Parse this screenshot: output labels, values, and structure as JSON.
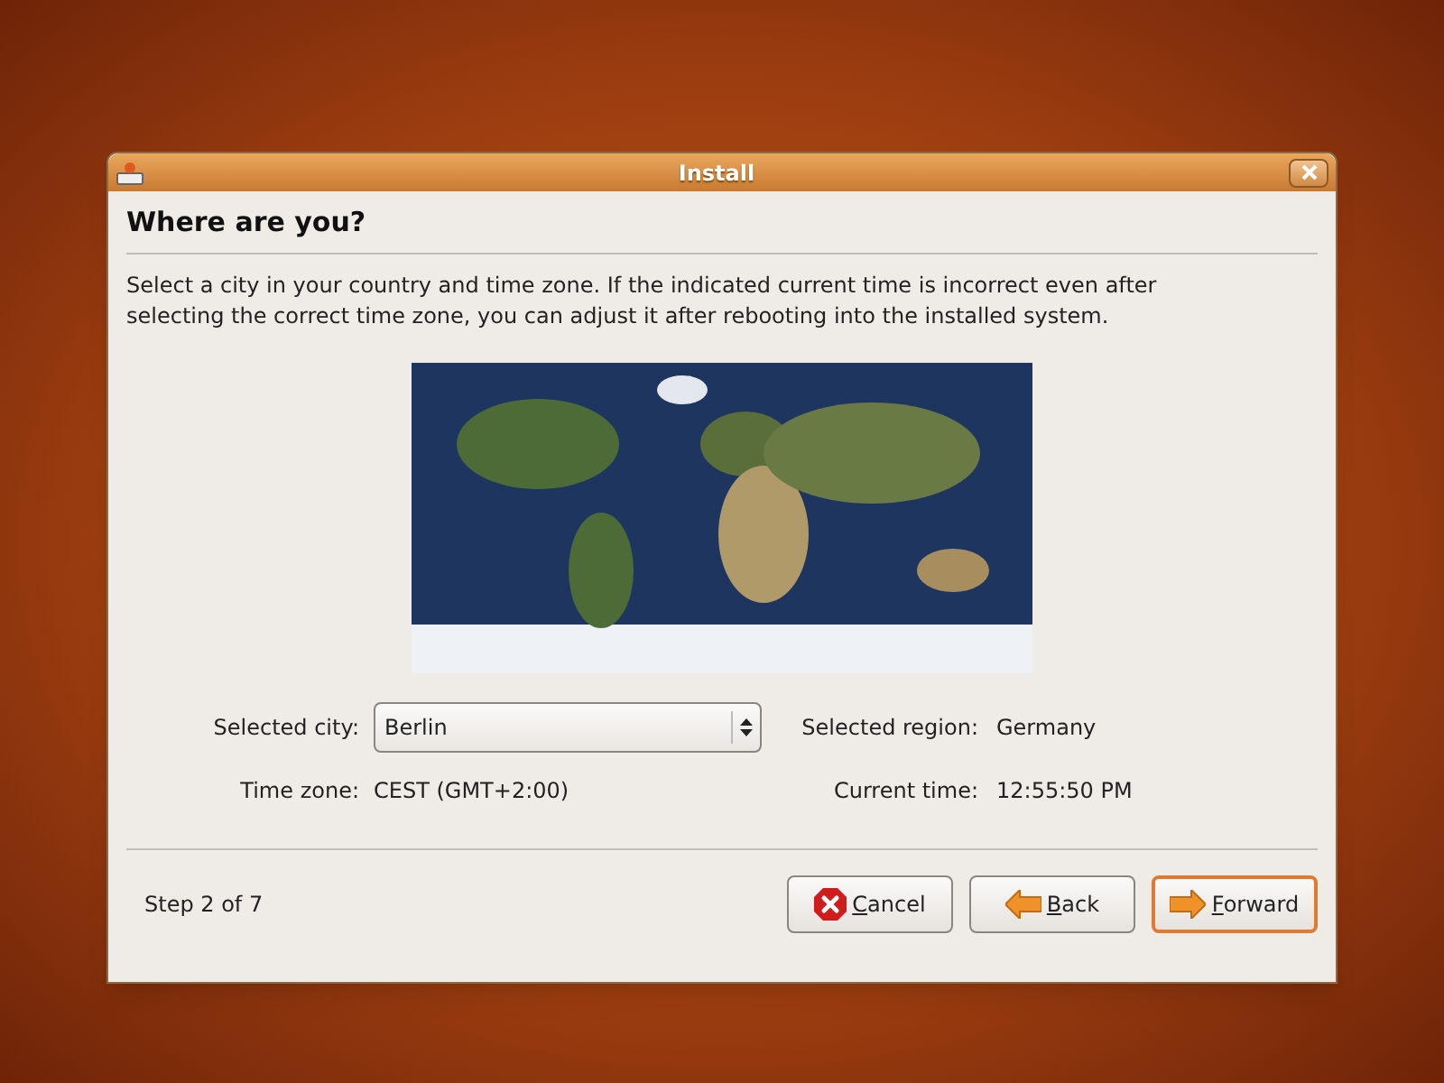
{
  "window": {
    "title": "Install"
  },
  "heading": "Where are you?",
  "description": "Select a city in your country and time zone. If the indicated current time is incorrect even after selecting the correct time zone, you can adjust it after rebooting into the installed system.",
  "fields": {
    "city_label": "Selected city:",
    "city_value": "Berlin",
    "region_label": "Selected region:",
    "region_value": "Germany",
    "timezone_label": "Time zone:",
    "timezone_value": "CEST (GMT+2:00)",
    "time_label": "Current time:",
    "time_value": "12:55:50 PM"
  },
  "step": "Step 2 of 7",
  "buttons": [
    {
      "kind": "cancel",
      "label": "Cancel",
      "default": false
    },
    {
      "kind": "back",
      "label": "Back",
      "default": false
    },
    {
      "kind": "forward",
      "label": "Forward",
      "default": true
    }
  ]
}
